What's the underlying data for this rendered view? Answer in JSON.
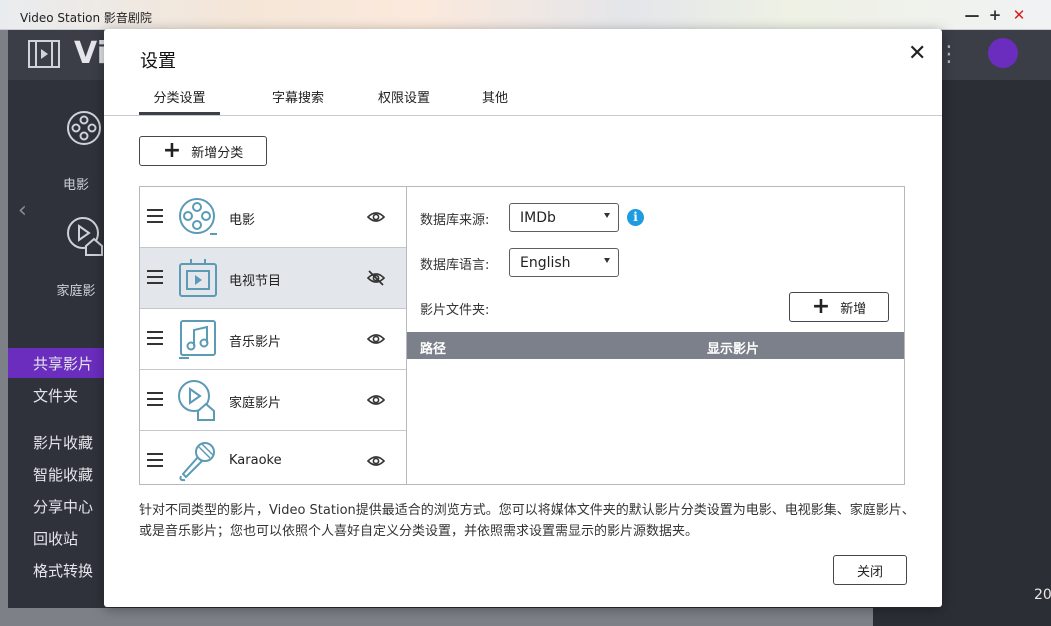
{
  "window": {
    "title": "Video Station 影音剧院",
    "minimize": "—",
    "maximize": "+",
    "close": "✕"
  },
  "app": {
    "title": "Vic",
    "more": "⋮",
    "sidebar_categories": [
      "电影",
      "家庭影"
    ],
    "sidebar_menu": [
      "共享影片",
      "文件夹",
      "影片收藏",
      "智能收藏",
      "分享中心",
      "回收站",
      "格式转换"
    ],
    "corner_text": "20",
    "accent_color": "#6a2dbd"
  },
  "dialog": {
    "title": "设置",
    "close_icon": "✕",
    "tabs": [
      {
        "label": "分类设置",
        "active": true
      },
      {
        "label": "字幕搜索",
        "active": false
      },
      {
        "label": "权限设置",
        "active": false
      },
      {
        "label": "其他",
        "active": false
      }
    ],
    "add_category_label": "新增分类",
    "categories": [
      {
        "label": "电影",
        "icon": "film-reel-icon",
        "visible": true
      },
      {
        "label": "电视节目",
        "icon": "tv-show-icon",
        "visible": false,
        "selected": true
      },
      {
        "label": "音乐影片",
        "icon": "music-video-icon",
        "visible": true
      },
      {
        "label": "家庭影片",
        "icon": "home-video-icon",
        "visible": true
      },
      {
        "label": "Karaoke",
        "icon": "microphone-icon",
        "visible": true
      }
    ],
    "detail": {
      "db_source_label": "数据库来源:",
      "db_source_value": "IMDb",
      "info_icon": "i",
      "db_language_label": "数据库语言:",
      "db_language_value": "English",
      "folder_label": "影片文件夹:",
      "add_folder_label": "新增",
      "columns": [
        "路径",
        "显示影片"
      ]
    },
    "description": "针对不同类型的影片，Video Station提供最适合的浏览方式。您可以将媒体文件夹的默认影片分类设置为电影、电视影集、家庭影片、或是音乐影片；您也可以依照个人喜好自定义分类设置，并依照需求设置需显示的影片源数据夹。",
    "close_label": "关闭",
    "icon_color": "#5b9bb5"
  }
}
